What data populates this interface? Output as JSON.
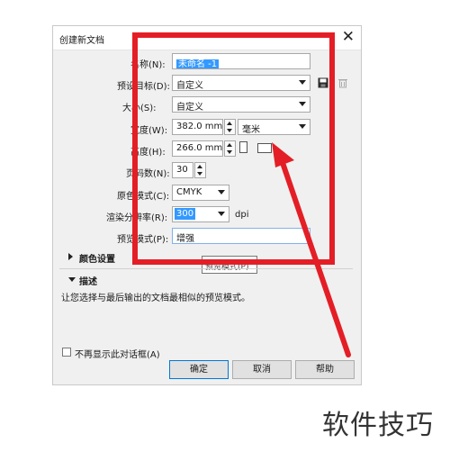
{
  "dialog": {
    "title": "创建新文档",
    "close_glyph": "✕"
  },
  "fields": {
    "name_label": "名称(N):",
    "name_value": "未命名 -1",
    "preset_label": "预设目标(D):",
    "preset_value": "自定义",
    "size_label": "大小(S):",
    "size_value": "自定义",
    "width_label": "宽度(W):",
    "width_value": "382.0 mm",
    "unit_value": "毫米",
    "height_label": "高度(H):",
    "height_value": "266.0 mm",
    "pages_label": "页码数(N):",
    "pages_value": "30",
    "color_mode_label": "原色模式(C):",
    "color_mode_value": "CMYK",
    "resolution_label": "渲染分辨率(R):",
    "resolution_value": "300",
    "resolution_unit": "dpi",
    "preview_label": "预览模式(P):",
    "preview_value": "增强"
  },
  "sections": {
    "color_settings": "颜色设置",
    "description": "描述",
    "description_text": "让您选择与最后输出的文档最相似的预览模式。"
  },
  "tooltip_text": "预览模式(P)",
  "checkbox_label": "不再显示此对话框(A)",
  "buttons": {
    "ok": "确定",
    "cancel": "取消",
    "help": "帮助"
  },
  "watermark": "软件技巧",
  "colors": {
    "highlight": "#e41e26",
    "selection": "#3399ff"
  }
}
